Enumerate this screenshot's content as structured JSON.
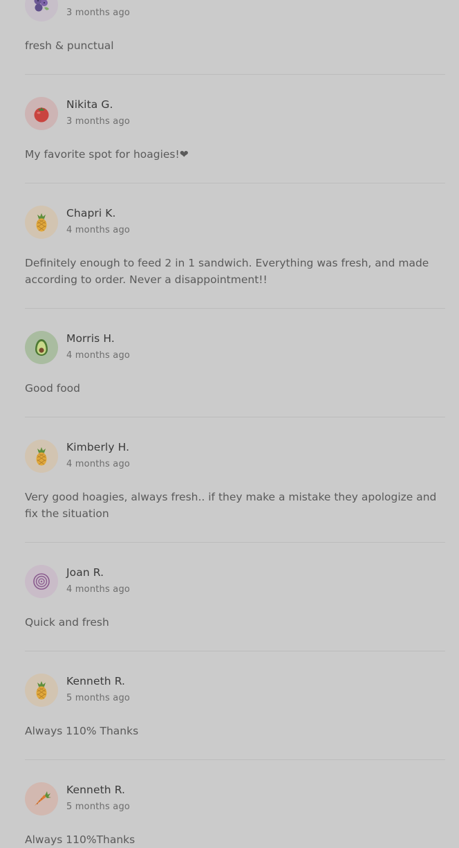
{
  "reviews": [
    {
      "name": "",
      "time": "3 months ago",
      "text": "fresh & punctual",
      "avatar": {
        "icon": "blueberry-icon",
        "bg": "#c7bfc9"
      }
    },
    {
      "name": "Nikita G.",
      "time": "3 months ago",
      "text": "My favorite spot for hoagies!❤",
      "avatar": {
        "icon": "tomato-icon",
        "bg": "#cdb4b4"
      }
    },
    {
      "name": "Chapri K.",
      "time": "4 months ago",
      "text": "Definitely enough to feed 2 in 1 sandwich. Everything was fresh, and made according to order. Never a disappointment!!",
      "avatar": {
        "icon": "pineapple-icon",
        "bg": "#d2c4b1"
      }
    },
    {
      "name": "Morris H.",
      "time": "4 months ago",
      "text": "Good food",
      "avatar": {
        "icon": "avocado-icon",
        "bg": "#a9bca0"
      }
    },
    {
      "name": "Kimberly H.",
      "time": "4 months ago",
      "text": "Very good hoagies, always fresh.. if they make a mistake they apologize and fix the situation",
      "avatar": {
        "icon": "pineapple-icon",
        "bg": "#d2c4b1"
      }
    },
    {
      "name": "Joan R.",
      "time": "4 months ago",
      "text": "Quick and fresh",
      "avatar": {
        "icon": "onion-icon",
        "bg": "#c9bcc8"
      }
    },
    {
      "name": "Kenneth R.",
      "time": "5 months ago",
      "text": "Always 110% Thanks",
      "avatar": {
        "icon": "pineapple-icon",
        "bg": "#d2c4b1"
      }
    },
    {
      "name": "Kenneth R.",
      "time": "5 months ago",
      "text": "Always 110%Thanks",
      "avatar": {
        "icon": "carrot-icon",
        "bg": "#d2b8b0"
      }
    }
  ]
}
